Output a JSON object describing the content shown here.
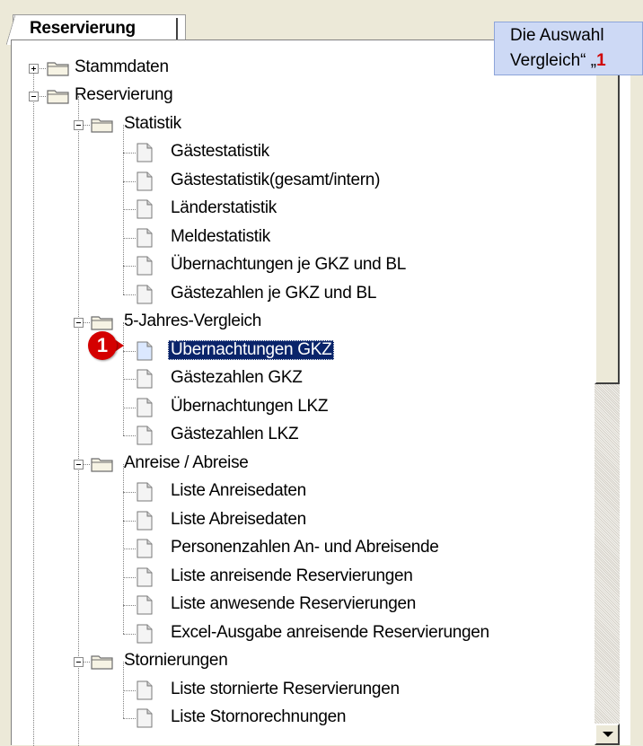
{
  "tab": {
    "label": "Reservierung"
  },
  "tooltip": {
    "line1": "Die Auswahl",
    "line2_prefix": "Vergleich“ „",
    "line2_accent": "1"
  },
  "badge": {
    "number": "1"
  },
  "colors": {
    "accent": "#d40000",
    "selection": "#0a246a",
    "tooltip_bg": "#cdd9f5"
  },
  "tree": {
    "nodes": [
      {
        "label": "Stammdaten",
        "level": 0,
        "type": "folder",
        "expanded": false
      },
      {
        "label": "Reservierung",
        "level": 0,
        "type": "folder",
        "expanded": true
      },
      {
        "label": "Statistik",
        "level": 1,
        "type": "folder",
        "expanded": true
      },
      {
        "label": "Gästestatistik",
        "level": 2,
        "type": "doc"
      },
      {
        "label": "Gästestatistik(gesamt/intern)",
        "level": 2,
        "type": "doc"
      },
      {
        "label": "Länderstatistik",
        "level": 2,
        "type": "doc"
      },
      {
        "label": "Meldestatistik",
        "level": 2,
        "type": "doc"
      },
      {
        "label": "Übernachtungen je GKZ und BL",
        "level": 2,
        "type": "doc"
      },
      {
        "label": "Gästezahlen je GKZ und BL",
        "level": 2,
        "type": "doc"
      },
      {
        "label": "5-Jahres-Vergleich",
        "level": 1,
        "type": "folder",
        "expanded": true
      },
      {
        "label": "Übernachtungen GKZ",
        "level": 2,
        "type": "doc",
        "selected": true
      },
      {
        "label": "Gästezahlen GKZ",
        "level": 2,
        "type": "doc"
      },
      {
        "label": "Übernachtungen LKZ",
        "level": 2,
        "type": "doc"
      },
      {
        "label": "Gästezahlen LKZ",
        "level": 2,
        "type": "doc"
      },
      {
        "label": "Anreise / Abreise",
        "level": 1,
        "type": "folder",
        "expanded": true
      },
      {
        "label": "Liste Anreisedaten",
        "level": 2,
        "type": "doc"
      },
      {
        "label": "Liste Abreisedaten",
        "level": 2,
        "type": "doc"
      },
      {
        "label": "Personenzahlen An- und Abreisende",
        "level": 2,
        "type": "doc"
      },
      {
        "label": "Liste anreisende Reservierungen",
        "level": 2,
        "type": "doc"
      },
      {
        "label": "Liste anwesende Reservierungen",
        "level": 2,
        "type": "doc"
      },
      {
        "label": "Excel-Ausgabe anreisende Reservierungen",
        "level": 2,
        "type": "doc"
      },
      {
        "label": "Stornierungen",
        "level": 1,
        "type": "folder",
        "expanded": true
      },
      {
        "label": "Liste stornierte Reservierungen",
        "level": 2,
        "type": "doc"
      },
      {
        "label": "Liste Stornorechnungen",
        "level": 2,
        "type": "doc"
      }
    ]
  }
}
